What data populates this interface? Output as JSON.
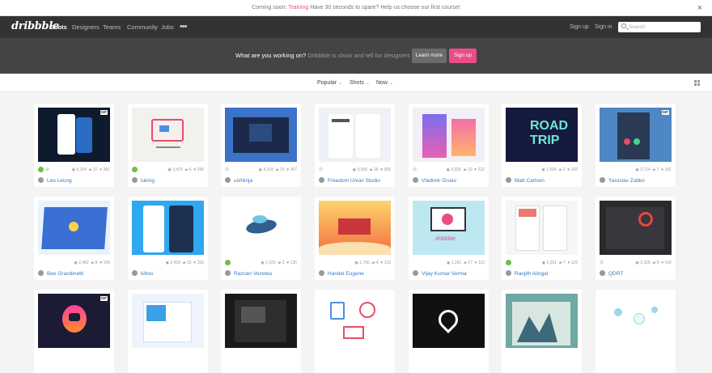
{
  "announcement": {
    "before": "Coming soon: ",
    "link": "Training",
    "after": " Have 30 seconds to spare? Help us choose our first course!",
    "close": "×"
  },
  "nav": {
    "logo": "dribbble",
    "items": [
      "Shots",
      "Designers",
      "Teams",
      "Community",
      "Jobs"
    ],
    "more": "•••",
    "signup": "Sign up",
    "signin": "Sign in",
    "search_placeholder": "Search"
  },
  "hero": {
    "question": "What are you working on?",
    "tagline": " Dribbble is show and tell for designers",
    "learn_more": "Learn more",
    "sign_up": "Sign up"
  },
  "filters": [
    {
      "label": "Popular"
    },
    {
      "label": "Shots"
    },
    {
      "label": "Now"
    }
  ],
  "shots": [
    {
      "author": "Leo Leung",
      "views": "5,104",
      "comments": "37",
      "likes": "382",
      "gif": "GIF",
      "rebound": true,
      "attach": true
    },
    {
      "author": "luking",
      "views": "3,475",
      "comments": "6",
      "likes": "290",
      "gif": "",
      "rebound": true,
      "attach": false
    },
    {
      "author": "uixNinja",
      "views": "4,318",
      "comments": "15",
      "likes": "367",
      "gif": "",
      "rebound": false,
      "attach": true
    },
    {
      "author": "Freedom Union Studio",
      "views": "3,250",
      "comments": "26",
      "likes": "205",
      "gif": "",
      "rebound": false,
      "attach": true
    },
    {
      "author": "Vladimir Gruev",
      "views": "3,325",
      "comments": "10",
      "likes": "222",
      "gif": "",
      "rebound": false,
      "attach": true
    },
    {
      "author": "Matt Carlson",
      "views": "1,564",
      "comments": "2",
      "likes": "182",
      "gif": "",
      "rebound": false,
      "attach": false
    },
    {
      "author": "Yaroslav Zubko",
      "views": "2,714",
      "comments": "7",
      "likes": "181",
      "gif": "GIF",
      "rebound": false,
      "attach": false
    },
    {
      "author": "Bee Grandinetti",
      "views": "2,482",
      "comments": "8",
      "likes": "156",
      "gif": "",
      "rebound": false,
      "attach": false
    },
    {
      "author": "kihoo",
      "views": "2,429",
      "comments": "15",
      "likes": "155",
      "gif": "",
      "rebound": false,
      "attach": false
    },
    {
      "author": "Razvan Vezeteu",
      "views": "1,623",
      "comments": "2",
      "likes": "135",
      "gif": "",
      "rebound": true,
      "attach": false
    },
    {
      "author": "Handel Eugene",
      "views": "1,790",
      "comments": "4",
      "likes": "133",
      "gif": "",
      "rebound": false,
      "attach": false
    },
    {
      "author": "Vijay Kumar Verma",
      "views": "1,261",
      "comments": "17",
      "likes": "115",
      "gif": "",
      "rebound": false,
      "attach": false
    },
    {
      "author": "Ranjith Alingal",
      "views": "2,261",
      "comments": "7",
      "likes": "115",
      "gif": "",
      "rebound": true,
      "attach": false
    },
    {
      "author": "QDRT",
      "views": "2,328",
      "comments": "8",
      "likes": "142",
      "gif": "",
      "rebound": false,
      "attach": true
    },
    {
      "author": "",
      "views": "",
      "comments": "",
      "likes": "",
      "gif": "GIF",
      "rebound": false,
      "attach": false
    },
    {
      "author": "",
      "views": "",
      "comments": "",
      "likes": "",
      "gif": "",
      "rebound": false,
      "attach": false
    },
    {
      "author": "",
      "views": "",
      "comments": "",
      "likes": "",
      "gif": "",
      "rebound": false,
      "attach": false
    },
    {
      "author": "",
      "views": "",
      "comments": "",
      "likes": "",
      "gif": "",
      "rebound": false,
      "attach": false
    },
    {
      "author": "",
      "views": "",
      "comments": "",
      "likes": "",
      "gif": "",
      "rebound": false,
      "attach": false
    },
    {
      "author": "",
      "views": "",
      "comments": "",
      "likes": "",
      "gif": "",
      "rebound": false,
      "attach": false
    },
    {
      "author": "",
      "views": "",
      "comments": "",
      "likes": "",
      "gif": "",
      "rebound": false,
      "attach": false
    }
  ],
  "colors": {
    "accent": "#ea4c89",
    "link": "#3a7bbf",
    "nav_bg": "#333333",
    "hero_bg": "#444444"
  }
}
